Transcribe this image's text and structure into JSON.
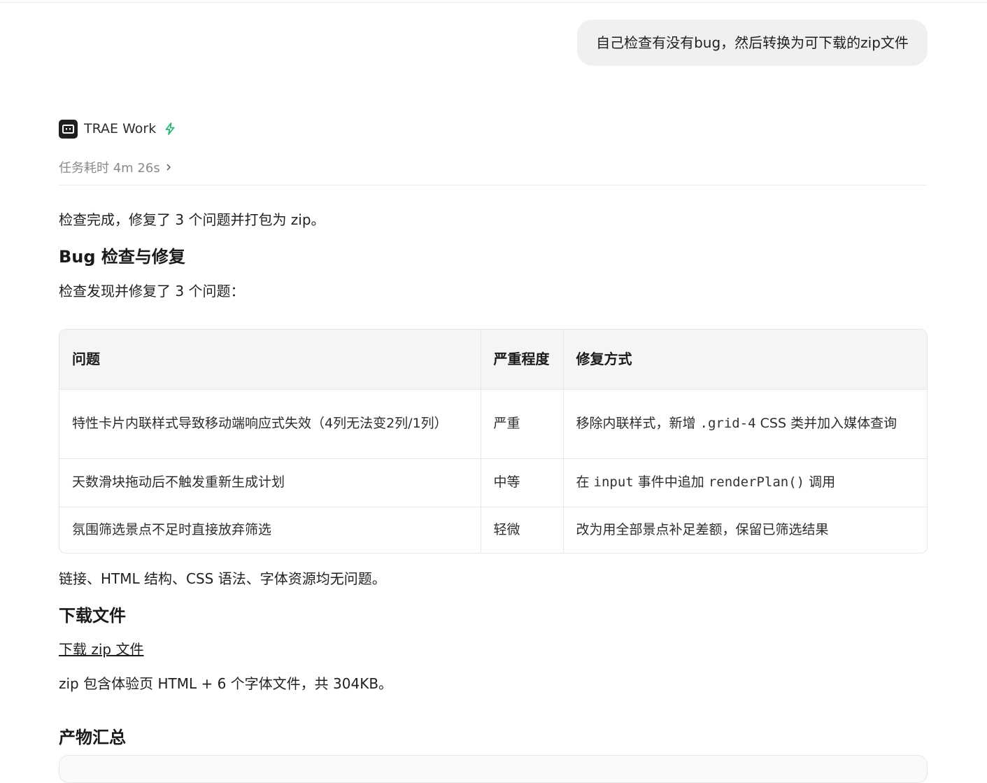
{
  "user_message": "自己检查有没有bug，然后转换为可下载的zip文件",
  "agent": {
    "name": "TRAE Work",
    "duration": "任务耗时 4m 26s"
  },
  "content": {
    "intro": "检查完成，修复了 3 个问题并打包为 zip。",
    "section_bug_title": "Bug 检查与修复",
    "bug_intro": "检查发现并修复了 3 个问题：",
    "table": {
      "headers": [
        "问题",
        "严重程度",
        "修复方式"
      ],
      "rows": [
        {
          "issue": "特性卡片内联样式导致移动端响应式失效（4列无法变2列/1列）",
          "severity": "严重",
          "fix_before": "移除内联样式，新增 ",
          "fix_code": ".grid-4",
          "fix_after": " CSS 类并加入媒体查询"
        },
        {
          "issue": "天数滑块拖动后不触发重新生成计划",
          "severity": "中等",
          "fix_before": "在 ",
          "fix_code": "input",
          "fix_mid": " 事件中追加 ",
          "fix_code2": "renderPlan()",
          "fix_after": " 调用"
        },
        {
          "issue": "氛围筛选景点不足时直接放弃筛选",
          "severity": "轻微",
          "fix": "改为用全部景点补足差额，保留已筛选结果"
        }
      ]
    },
    "after_table": "链接、HTML 结构、CSS 语法、字体资源均无问题。",
    "section_download_title": "下载文件",
    "download_link": "下载 zip 文件",
    "download_note": "zip 包含体验页 HTML + 6 个字体文件，共 304KB。",
    "section_summary_title": "产物汇总"
  }
}
